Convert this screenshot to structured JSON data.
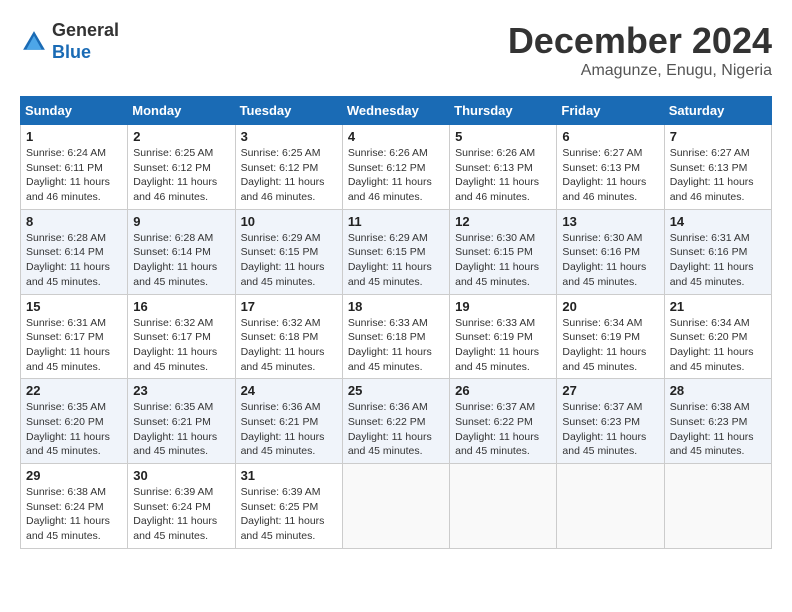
{
  "header": {
    "logo": {
      "line1": "General",
      "line2": "Blue"
    },
    "title": "December 2024",
    "location": "Amagunze, Enugu, Nigeria"
  },
  "calendar": {
    "days_of_week": [
      "Sunday",
      "Monday",
      "Tuesday",
      "Wednesday",
      "Thursday",
      "Friday",
      "Saturday"
    ],
    "weeks": [
      [
        {
          "day": "1",
          "sunrise": "6:24 AM",
          "sunset": "6:11 PM",
          "daylight": "11 hours and 46 minutes."
        },
        {
          "day": "2",
          "sunrise": "6:25 AM",
          "sunset": "6:12 PM",
          "daylight": "11 hours and 46 minutes."
        },
        {
          "day": "3",
          "sunrise": "6:25 AM",
          "sunset": "6:12 PM",
          "daylight": "11 hours and 46 minutes."
        },
        {
          "day": "4",
          "sunrise": "6:26 AM",
          "sunset": "6:12 PM",
          "daylight": "11 hours and 46 minutes."
        },
        {
          "day": "5",
          "sunrise": "6:26 AM",
          "sunset": "6:13 PM",
          "daylight": "11 hours and 46 minutes."
        },
        {
          "day": "6",
          "sunrise": "6:27 AM",
          "sunset": "6:13 PM",
          "daylight": "11 hours and 46 minutes."
        },
        {
          "day": "7",
          "sunrise": "6:27 AM",
          "sunset": "6:13 PM",
          "daylight": "11 hours and 46 minutes."
        }
      ],
      [
        {
          "day": "8",
          "sunrise": "6:28 AM",
          "sunset": "6:14 PM",
          "daylight": "11 hours and 45 minutes."
        },
        {
          "day": "9",
          "sunrise": "6:28 AM",
          "sunset": "6:14 PM",
          "daylight": "11 hours and 45 minutes."
        },
        {
          "day": "10",
          "sunrise": "6:29 AM",
          "sunset": "6:15 PM",
          "daylight": "11 hours and 45 minutes."
        },
        {
          "day": "11",
          "sunrise": "6:29 AM",
          "sunset": "6:15 PM",
          "daylight": "11 hours and 45 minutes."
        },
        {
          "day": "12",
          "sunrise": "6:30 AM",
          "sunset": "6:15 PM",
          "daylight": "11 hours and 45 minutes."
        },
        {
          "day": "13",
          "sunrise": "6:30 AM",
          "sunset": "6:16 PM",
          "daylight": "11 hours and 45 minutes."
        },
        {
          "day": "14",
          "sunrise": "6:31 AM",
          "sunset": "6:16 PM",
          "daylight": "11 hours and 45 minutes."
        }
      ],
      [
        {
          "day": "15",
          "sunrise": "6:31 AM",
          "sunset": "6:17 PM",
          "daylight": "11 hours and 45 minutes."
        },
        {
          "day": "16",
          "sunrise": "6:32 AM",
          "sunset": "6:17 PM",
          "daylight": "11 hours and 45 minutes."
        },
        {
          "day": "17",
          "sunrise": "6:32 AM",
          "sunset": "6:18 PM",
          "daylight": "11 hours and 45 minutes."
        },
        {
          "day": "18",
          "sunrise": "6:33 AM",
          "sunset": "6:18 PM",
          "daylight": "11 hours and 45 minutes."
        },
        {
          "day": "19",
          "sunrise": "6:33 AM",
          "sunset": "6:19 PM",
          "daylight": "11 hours and 45 minutes."
        },
        {
          "day": "20",
          "sunrise": "6:34 AM",
          "sunset": "6:19 PM",
          "daylight": "11 hours and 45 minutes."
        },
        {
          "day": "21",
          "sunrise": "6:34 AM",
          "sunset": "6:20 PM",
          "daylight": "11 hours and 45 minutes."
        }
      ],
      [
        {
          "day": "22",
          "sunrise": "6:35 AM",
          "sunset": "6:20 PM",
          "daylight": "11 hours and 45 minutes."
        },
        {
          "day": "23",
          "sunrise": "6:35 AM",
          "sunset": "6:21 PM",
          "daylight": "11 hours and 45 minutes."
        },
        {
          "day": "24",
          "sunrise": "6:36 AM",
          "sunset": "6:21 PM",
          "daylight": "11 hours and 45 minutes."
        },
        {
          "day": "25",
          "sunrise": "6:36 AM",
          "sunset": "6:22 PM",
          "daylight": "11 hours and 45 minutes."
        },
        {
          "day": "26",
          "sunrise": "6:37 AM",
          "sunset": "6:22 PM",
          "daylight": "11 hours and 45 minutes."
        },
        {
          "day": "27",
          "sunrise": "6:37 AM",
          "sunset": "6:23 PM",
          "daylight": "11 hours and 45 minutes."
        },
        {
          "day": "28",
          "sunrise": "6:38 AM",
          "sunset": "6:23 PM",
          "daylight": "11 hours and 45 minutes."
        }
      ],
      [
        {
          "day": "29",
          "sunrise": "6:38 AM",
          "sunset": "6:24 PM",
          "daylight": "11 hours and 45 minutes."
        },
        {
          "day": "30",
          "sunrise": "6:39 AM",
          "sunset": "6:24 PM",
          "daylight": "11 hours and 45 minutes."
        },
        {
          "day": "31",
          "sunrise": "6:39 AM",
          "sunset": "6:25 PM",
          "daylight": "11 hours and 45 minutes."
        },
        null,
        null,
        null,
        null
      ]
    ],
    "labels": {
      "sunrise": "Sunrise:",
      "sunset": "Sunset:",
      "daylight": "Daylight:"
    }
  }
}
